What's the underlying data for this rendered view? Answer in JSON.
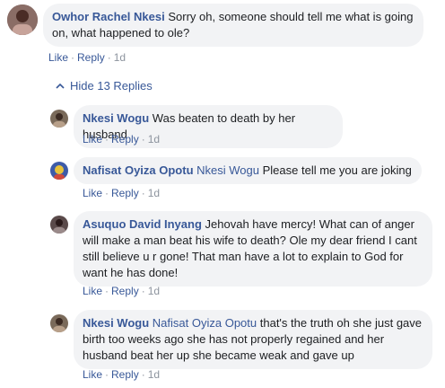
{
  "thread": {
    "top_comment": {
      "author": "Owhor Rachel Nkesi",
      "text": "Sorry oh, someone should tell me what is going on, what happened to ole?",
      "actions": {
        "like": "Like",
        "reply": "Reply",
        "time": "1d"
      }
    },
    "toggle_label": "Hide 13 Replies",
    "replies": [
      {
        "author": "Nkesi Wogu",
        "mention": "",
        "text": "Was beaten to death by her husband",
        "actions": {
          "like": "Like",
          "reply": "Reply",
          "time": "1d"
        }
      },
      {
        "author": "Nafisat Oyiza Opotu",
        "mention": "Nkesi Wogu",
        "text": "Please tell me you are joking",
        "actions": {
          "like": "Like",
          "reply": "Reply",
          "time": "1d"
        }
      },
      {
        "author": "Asuquo David Inyang",
        "mention": "",
        "text": "Jehovah have mercy! What can of anger will make a man beat his wife to death? Ole my dear friend I cant still believe u r gone! That man have a lot to explain to God for want he has done!",
        "actions": {
          "like": "Like",
          "reply": "Reply",
          "time": "1d"
        }
      },
      {
        "author": "Nkesi Wogu",
        "mention": "Nafisat Oyiza Opotu",
        "text": "that's the truth oh she just gave birth too weeks ago she has not properly regained and her husband beat her up she became weak and gave up",
        "actions": {
          "like": "Like",
          "reply": "Reply",
          "time": "1d"
        }
      }
    ]
  },
  "colors": {
    "link": "#385898",
    "bubble": "#f2f3f5",
    "meta": "#8d949e"
  }
}
